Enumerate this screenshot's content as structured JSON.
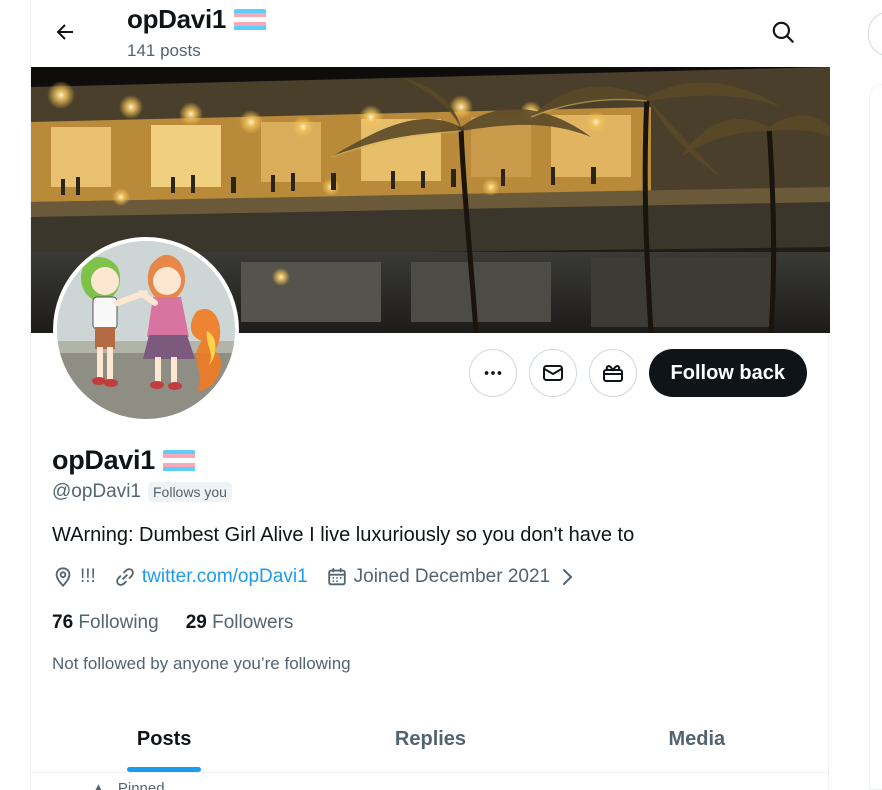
{
  "header": {
    "title": "opDavi1",
    "post_count": "141 posts"
  },
  "flag_colors": [
    "#5bcefa",
    "#f5a9b8",
    "#ffffff",
    "#f5a9b8",
    "#5bcefa"
  ],
  "profile": {
    "display_name": "opDavi1",
    "handle": "@opDavi1",
    "follows_you": "Follows you",
    "bio": "WArning: Dumbest Girl Alive I live luxuriously so you don't have to",
    "location": "!!!",
    "website": "twitter.com/opDavi1",
    "joined": "Joined December 2021",
    "following_count": "76",
    "following_label": "Following",
    "followers_count": "29",
    "followers_label": "Followers",
    "not_followed_note": "Not followed by anyone you’re following"
  },
  "actions": {
    "more_icon": "more-icon",
    "message_icon": "mail-icon",
    "gift_icon": "gift-icon",
    "follow_back_label": "Follow back"
  },
  "tabs": [
    {
      "label": "Posts",
      "active": true
    },
    {
      "label": "Replies",
      "active": false
    },
    {
      "label": "Media",
      "active": false
    }
  ],
  "pinned_peek": "Pinned",
  "colors": {
    "accent": "#1d9bf0",
    "text_primary": "#0f1419",
    "text_secondary": "#536471",
    "follow_button_bg": "#0f1419"
  }
}
